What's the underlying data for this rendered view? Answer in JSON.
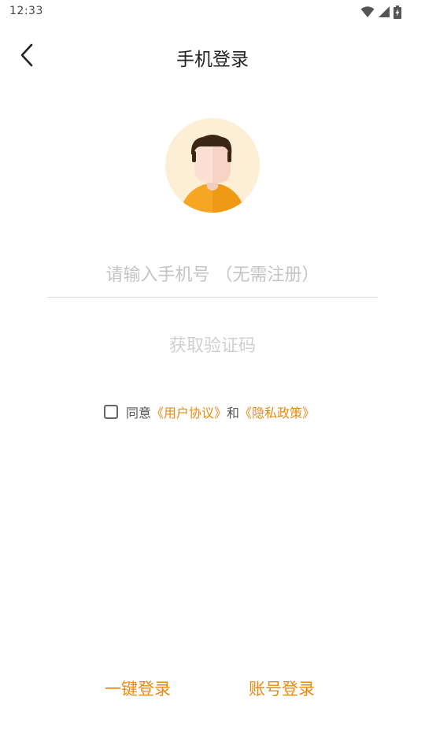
{
  "status_bar": {
    "time": "12:33",
    "icons": [
      "wifi-icon",
      "signal-icon",
      "battery-icon"
    ]
  },
  "header": {
    "back_icon": "chevron-left-icon",
    "title": "手机登录"
  },
  "avatar": {
    "icon": "user-avatar-icon",
    "colors": {
      "background": "#fdeed6",
      "shirt": "#f5a623",
      "hair": "#3a2613",
      "skin": "#fbe0d3"
    }
  },
  "phone_input": {
    "value": "",
    "placeholder": "请输入手机号 （无需注册）"
  },
  "get_code_label": "获取验证码",
  "agreement": {
    "checked": false,
    "prefix": "同意",
    "user_agreement": "《用户协议》",
    "conjunction": "和",
    "privacy_policy": "《隐私政策》"
  },
  "bottom": {
    "quick_login": "一键登录",
    "account_login": "账号登录"
  },
  "colors": {
    "accent": "#e98a10",
    "placeholder": "#c4c4c4",
    "disabled_text": "#d0d0d0"
  }
}
